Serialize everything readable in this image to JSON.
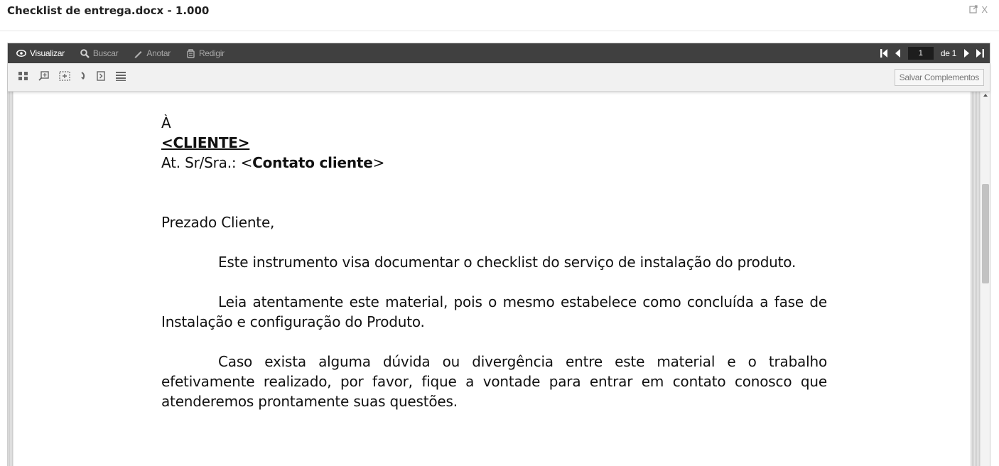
{
  "window": {
    "title": "Checklist de entrega.docx - 1.000",
    "controls": {
      "popout_icon": "popout-icon",
      "close_label": "X"
    }
  },
  "toolbar": {
    "tools": {
      "view": {
        "label": "Visualizar",
        "icon": "eye-icon",
        "active": true
      },
      "search": {
        "label": "Buscar",
        "icon": "search-icon"
      },
      "annotate": {
        "label": "Anotar",
        "icon": "pencil-icon"
      },
      "redact": {
        "label": "Redigir",
        "icon": "redact-icon"
      }
    },
    "pager": {
      "current_page": "1",
      "of_label": "de 1"
    }
  },
  "subtoolbar": {
    "icons": [
      "thumbnails-icon",
      "zoom-icon",
      "fit-page-icon",
      "rotate-icon",
      "next-page-icon",
      "menu-icon"
    ],
    "save_label": "Salvar Complementos"
  },
  "document": {
    "line_to": "À",
    "client": "<CLIENTE>",
    "attn_prefix": "At. Sr/Sra.: <",
    "attn_contact": "Contato cliente",
    "attn_suffix": ">",
    "greeting": "Prezado Cliente,",
    "paragraphs": [
      "Este instrumento visa documentar o checklist do serviço de instalação do produto.",
      "Leia atentamente este material, pois o mesmo estabelece como concluída a fase de Instalação e configuração do Produto.",
      "Caso exista alguma dúvida ou divergência entre este material e o trabalho efetivamente realizado, por favor, fique a vontade para entrar em contato conosco que atenderemos prontamente suas questões."
    ]
  },
  "colors": {
    "toolbar_bg": "#404040",
    "subtoolbar_bg": "#f1f1f1",
    "page_bg": "#ffffff"
  }
}
